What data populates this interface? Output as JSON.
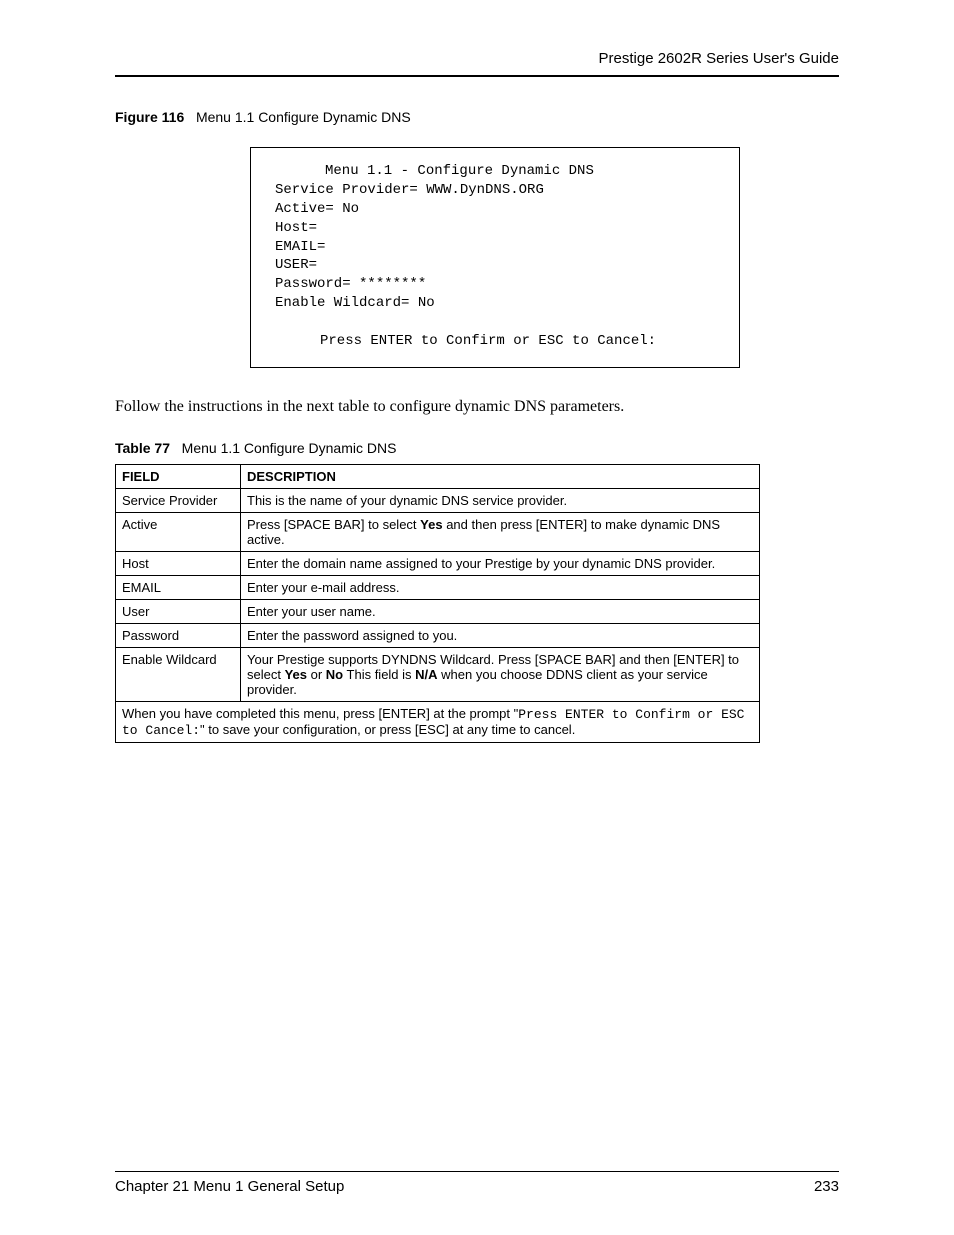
{
  "header": "Prestige 2602R Series User's Guide",
  "figure_prefix": "Figure 116",
  "figure_title": "Menu 1.1 Configure Dynamic DNS",
  "terminal": {
    "title": "Menu 1.1 - Configure Dynamic DNS",
    "lines": [
      "Service Provider= WWW.DynDNS.ORG",
      "Active= No",
      "Host=",
      "EMAIL=",
      "USER=",
      "Password= ********",
      "Enable Wildcard= No"
    ],
    "prompt": "Press ENTER to Confirm or ESC to Cancel:"
  },
  "paragraph": "Follow the instructions in the next table to configure dynamic DNS parameters.",
  "table_prefix": "Table 77",
  "table_title": "Menu 1.1 Configure Dynamic DNS",
  "table": {
    "heads": [
      "FIELD",
      "DESCRIPTION"
    ],
    "rows": [
      {
        "field": "Service Provider",
        "desc_pre": "This is the name of your dynamic DNS service provider."
      },
      {
        "field": "Active",
        "desc_pre": "Press [SPACE BAR] to select ",
        "bold1": "Yes",
        "desc_mid": " and then press [ENTER] to make dynamic DNS active."
      },
      {
        "field": "Host",
        "desc_pre": "Enter the domain name assigned to your Prestige by your dynamic DNS provider."
      },
      {
        "field": "EMAIL",
        "desc_pre": "Enter your e-mail address."
      },
      {
        "field": "User",
        "desc_pre": "Enter your user name."
      },
      {
        "field": "Password",
        "desc_pre": "Enter the password assigned to you."
      },
      {
        "field": "Enable Wildcard",
        "desc_pre": "Your Prestige supports DYNDNS Wildcard. Press [SPACE BAR] and then [ENTER] to select ",
        "bold1": "Yes",
        "desc_mid": " or ",
        "bold2": "No",
        "desc_mid2": " This field is ",
        "bold3": "N/A",
        "desc_post": " when you choose DDNS client as your service provider."
      }
    ],
    "footrow": {
      "pre": "When you have completed this menu, press [ENTER] at the prompt \"",
      "mono": "Press ENTER to Confirm or ESC to Cancel:",
      "post": "\" to save your configuration, or press [ESC] at any time to cancel."
    }
  },
  "footer_left": "Chapter 21 Menu 1 General Setup",
  "footer_right": "233"
}
